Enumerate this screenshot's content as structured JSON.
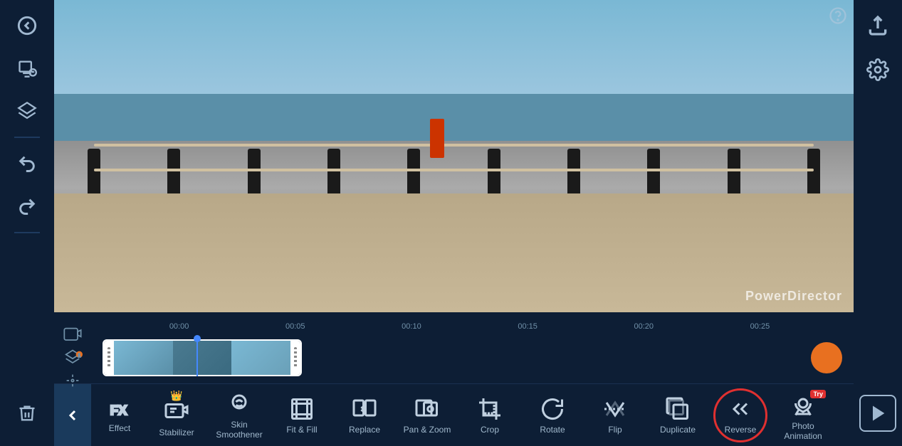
{
  "app": {
    "title": "PowerDirector"
  },
  "left_sidebar": {
    "back_label": "back",
    "media_label": "media",
    "layers_label": "layers",
    "undo_label": "undo",
    "redo_label": "redo",
    "delete_label": "delete"
  },
  "timeline": {
    "ruler_marks": [
      "00:00",
      "00:05",
      "00:10",
      "00:15",
      "00:20",
      "00:25"
    ]
  },
  "toolbar": {
    "back_label": "<",
    "items": [
      {
        "id": "fx",
        "label": "Effect",
        "has_crown": false
      },
      {
        "id": "stabilizer",
        "label": "Stabilizer",
        "has_crown": true
      },
      {
        "id": "skin-smoothener",
        "label": "Skin\nSmoothener",
        "has_crown": false
      },
      {
        "id": "fit-fill",
        "label": "Fit & Fill",
        "has_crown": false
      },
      {
        "id": "replace",
        "label": "Replace",
        "has_crown": false
      },
      {
        "id": "pan-zoom",
        "label": "Pan & Zoom",
        "has_crown": false
      },
      {
        "id": "crop",
        "label": "Crop",
        "has_crown": false
      },
      {
        "id": "rotate",
        "label": "Rotate",
        "has_crown": false
      },
      {
        "id": "flip",
        "label": "Flip",
        "has_crown": false
      },
      {
        "id": "duplicate",
        "label": "Duplicate",
        "has_crown": false
      },
      {
        "id": "reverse",
        "label": "Reverse",
        "has_crown": false,
        "highlighted": true
      },
      {
        "id": "photo-animation",
        "label": "Photo\nAnimation",
        "has_crown": false,
        "try_badge": true
      }
    ]
  },
  "colors": {
    "bg_dark": "#0a1628",
    "sidebar_bg": "#0d1e35",
    "accent_blue": "#4488ff",
    "accent_orange": "#e87020",
    "highlight_red": "#e03030",
    "text_muted": "#7090a8"
  }
}
